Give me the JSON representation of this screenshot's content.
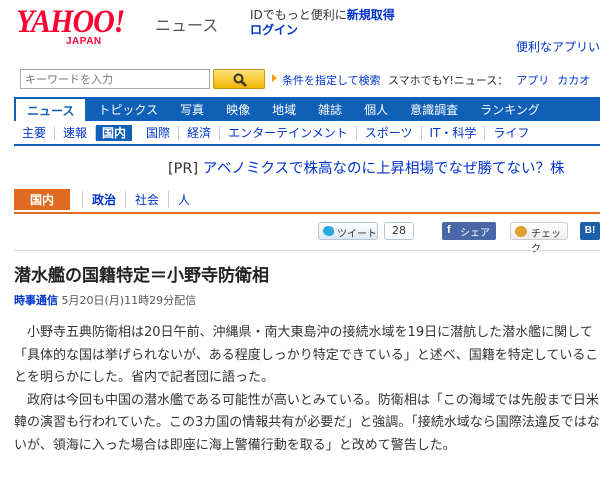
{
  "header": {
    "logo_text": "YAHOO!",
    "logo_sub": "JAPAN",
    "site_name": "ニュース",
    "tagline": "IDでもっと便利に",
    "register_link": "新規取得",
    "login_link": "ログイン",
    "convenient_app": "便利なアプリい"
  },
  "search": {
    "placeholder": "キーワードを入力",
    "advanced_link": "条件を指定して検索",
    "smartphone_text": "スマホでもY!ニュース：",
    "app_link": "アプリ",
    "calendar_link": "カカオ"
  },
  "main_nav": [
    {
      "label": "ニュース"
    },
    {
      "label": "トピックス"
    },
    {
      "label": "写真"
    },
    {
      "label": "映像"
    },
    {
      "label": "地域"
    },
    {
      "label": "雑誌"
    },
    {
      "label": "個人"
    },
    {
      "label": "意識調査"
    },
    {
      "label": "ランキング"
    }
  ],
  "sub_nav": [
    {
      "label": "主要"
    },
    {
      "label": "速報"
    },
    {
      "label": "国内"
    },
    {
      "label": "国際"
    },
    {
      "label": "経済"
    },
    {
      "label": "エンターテインメント"
    },
    {
      "label": "スポーツ"
    },
    {
      "label": "IT・科学"
    },
    {
      "label": "ライフ"
    }
  ],
  "pr": {
    "tag": "[PR]",
    "text": "アベノミクスで株高なのに上昇相場でなぜ勝てない？株"
  },
  "category": {
    "badge": "国内",
    "links": [
      "政治",
      "社会",
      "人"
    ]
  },
  "social": {
    "tweet_label": "ツイート",
    "tweet_count": "28",
    "share_label": "シェア",
    "check_label": "チェック",
    "hatena_label": "B!"
  },
  "article": {
    "title": "潜水艦の国籍特定＝小野寺防衛相",
    "source": "時事通信",
    "datetime": "5月20日(月)11時29分配信",
    "paragraphs": [
      "小野寺五典防衛相は20日午前、沖縄県・南大東島沖の接続水域を19日に潜航した潜水艦に関して「具体的な国は挙げられないが、ある程度しっかり特定できている」と述べ、国籍を特定していることを明らかにした。省内で記者団に語った。",
      "政府は今回も中国の潜水艦である可能性が高いとみている。防衛相は「この海域では先般まで日米韓の演習も行われていた。この3カ国の情報共有が必要だ」と強調。「接続水域なら国際法違反ではないが、領海に入った場合は即座に海上警備行動を取る」と改めて警告した。"
    ]
  },
  "colors": {
    "brand_red": "#ff0033",
    "nav_blue": "#1060b8",
    "category_orange": "#e06a20",
    "link_blue": "#0033cc"
  }
}
